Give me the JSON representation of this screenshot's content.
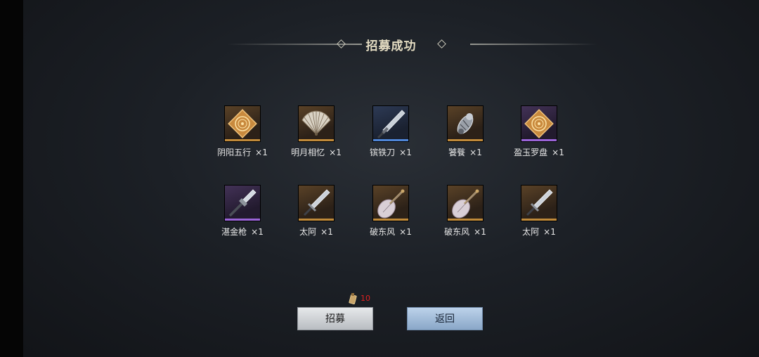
{
  "title": "招募成功",
  "items": [
    {
      "name": "阴阳五行",
      "count": "×1",
      "quality": "gold",
      "icon": "bagua-plate-icon"
    },
    {
      "name": "明月相忆",
      "count": "×1",
      "quality": "gold",
      "icon": "folding-fan-icon"
    },
    {
      "name": "镔铁刀",
      "count": "×1",
      "quality": "blue",
      "icon": "saber-icon"
    },
    {
      "name": "饕餮",
      "count": "×1",
      "quality": "gold",
      "icon": "beast-gauntlet-icon"
    },
    {
      "name": "盈玉罗盘",
      "count": "×1",
      "quality": "purple",
      "icon": "compass-plate-icon"
    },
    {
      "name": "湛金枪",
      "count": "×1",
      "quality": "purple",
      "icon": "spear-icon"
    },
    {
      "name": "太阿",
      "count": "×1",
      "quality": "gold",
      "icon": "sword-icon"
    },
    {
      "name": "破东风",
      "count": "×1",
      "quality": "gold",
      "icon": "pipa-icon"
    },
    {
      "name": "破东风",
      "count": "×1",
      "quality": "gold",
      "icon": "pipa-icon"
    },
    {
      "name": "太阿",
      "count": "×1",
      "quality": "gold",
      "icon": "sword-icon"
    }
  ],
  "cost": {
    "icon": "recruit-token-icon",
    "amount": "10"
  },
  "buttons": {
    "recruit": "招募",
    "back": "返回"
  },
  "colors": {
    "title": "#e4dcc2",
    "cost": "#e02020",
    "gold": "#c08a3a",
    "blue": "#4f86d8",
    "purple": "#9a64d8"
  }
}
